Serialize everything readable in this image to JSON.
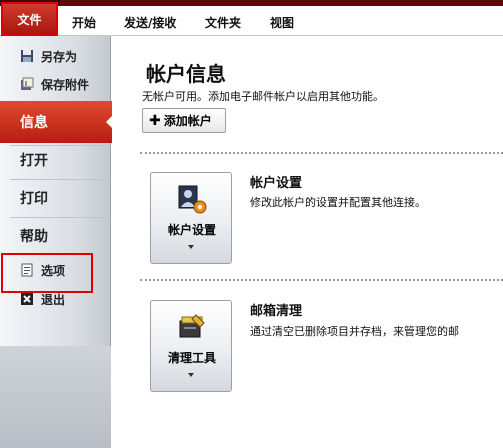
{
  "ribbon": {
    "file_tab": "文件",
    "tabs": [
      "开始",
      "发送/接收",
      "文件夹",
      "视图"
    ]
  },
  "nav": {
    "save_as": "另存为",
    "save_attachments": "保存附件",
    "info": "信息",
    "open": "打开",
    "print": "打印",
    "help": "帮助",
    "options": "选项",
    "exit": "退出"
  },
  "main": {
    "title": "帐户信息",
    "description": "无帐户可用。添加电子邮件帐户以启用其他功能。",
    "add_account": "添加帐户",
    "sections": [
      {
        "button_label": "帐户设置",
        "title": "帐户设置",
        "description": "修改此帐户的设置并配置其他连接。"
      },
      {
        "button_label": "清理工具",
        "title": "邮箱清理",
        "description": "通过清空已删除项目并存档，来管理您的邮"
      }
    ]
  },
  "colors": {
    "file_tab": "#b8241a",
    "selected_nav": "#c92d1c",
    "highlight_box": "#e00000"
  }
}
